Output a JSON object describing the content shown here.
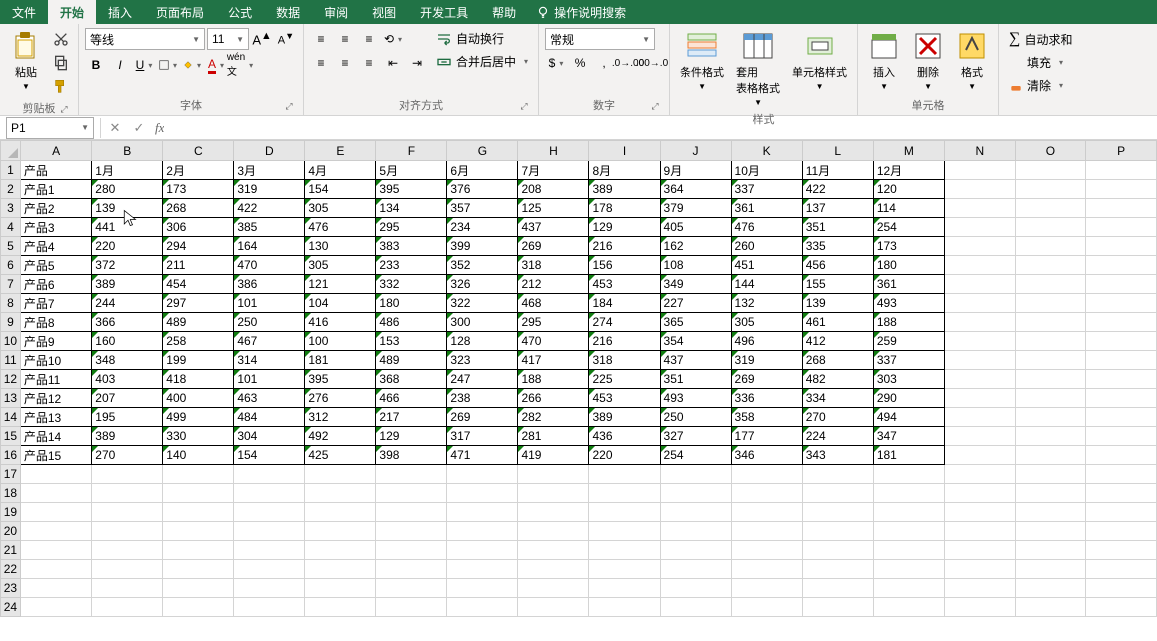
{
  "tabs": {
    "file": "文件",
    "home": "开始",
    "insert": "插入",
    "pagelayout": "页面布局",
    "formulas": "公式",
    "data": "数据",
    "review": "审阅",
    "view": "视图",
    "developer": "开发工具",
    "help": "帮助",
    "tellme": "操作说明搜索"
  },
  "ribbon": {
    "clipboard": {
      "label": "剪贴板",
      "paste": "粘贴"
    },
    "font": {
      "label": "字体",
      "name": "等线",
      "size": "11"
    },
    "alignment": {
      "label": "对齐方式",
      "wrap": "自动换行",
      "merge": "合并后居中"
    },
    "number": {
      "label": "数字",
      "format": "常规"
    },
    "styles": {
      "label": "样式",
      "conditional": "条件格式",
      "tableformat": "套用\n表格格式",
      "cellstyles": "单元格样式"
    },
    "cells": {
      "label": "单元格",
      "insert": "插入",
      "delete": "删除",
      "format": "格式"
    },
    "editing": {
      "autosum": "自动求和",
      "fill": "填充",
      "clear": "清除"
    }
  },
  "namebox": "P1",
  "columns": [
    "A",
    "B",
    "C",
    "D",
    "E",
    "F",
    "G",
    "H",
    "I",
    "J",
    "K",
    "L",
    "M",
    "N",
    "O",
    "P"
  ],
  "data_col_count": 13,
  "headers": [
    "产品",
    "1月",
    "2月",
    "3月",
    "4月",
    "5月",
    "6月",
    "7月",
    "8月",
    "9月",
    "10月",
    "11月",
    "12月"
  ],
  "rows": [
    [
      "产品1",
      "280",
      "173",
      "319",
      "154",
      "395",
      "376",
      "208",
      "389",
      "364",
      "337",
      "422",
      "120"
    ],
    [
      "产品2",
      "139",
      "268",
      "422",
      "305",
      "134",
      "357",
      "125",
      "178",
      "379",
      "361",
      "137",
      "114"
    ],
    [
      "产品3",
      "441",
      "306",
      "385",
      "476",
      "295",
      "234",
      "437",
      "129",
      "405",
      "476",
      "351",
      "254"
    ],
    [
      "产品4",
      "220",
      "294",
      "164",
      "130",
      "383",
      "399",
      "269",
      "216",
      "162",
      "260",
      "335",
      "173"
    ],
    [
      "产品5",
      "372",
      "211",
      "470",
      "305",
      "233",
      "352",
      "318",
      "156",
      "108",
      "451",
      "456",
      "180"
    ],
    [
      "产品6",
      "389",
      "454",
      "386",
      "121",
      "332",
      "326",
      "212",
      "453",
      "349",
      "144",
      "155",
      "361"
    ],
    [
      "产品7",
      "244",
      "297",
      "101",
      "104",
      "180",
      "322",
      "468",
      "184",
      "227",
      "132",
      "139",
      "493"
    ],
    [
      "产品8",
      "366",
      "489",
      "250",
      "416",
      "486",
      "300",
      "295",
      "274",
      "365",
      "305",
      "461",
      "188"
    ],
    [
      "产品9",
      "160",
      "258",
      "467",
      "100",
      "153",
      "128",
      "470",
      "216",
      "354",
      "496",
      "412",
      "259"
    ],
    [
      "产品10",
      "348",
      "199",
      "314",
      "181",
      "489",
      "323",
      "417",
      "318",
      "437",
      "319",
      "268",
      "337"
    ],
    [
      "产品11",
      "403",
      "418",
      "101",
      "395",
      "368",
      "247",
      "188",
      "225",
      "351",
      "269",
      "482",
      "303"
    ],
    [
      "产品12",
      "207",
      "400",
      "463",
      "276",
      "466",
      "238",
      "266",
      "453",
      "493",
      "336",
      "334",
      "290"
    ],
    [
      "产品13",
      "195",
      "499",
      "484",
      "312",
      "217",
      "269",
      "282",
      "389",
      "250",
      "358",
      "270",
      "494"
    ],
    [
      "产品14",
      "389",
      "330",
      "304",
      "492",
      "129",
      "317",
      "281",
      "436",
      "327",
      "177",
      "224",
      "347"
    ],
    [
      "产品15",
      "270",
      "140",
      "154",
      "425",
      "398",
      "471",
      "419",
      "220",
      "254",
      "346",
      "343",
      "181"
    ]
  ],
  "total_visible_rows": 24
}
